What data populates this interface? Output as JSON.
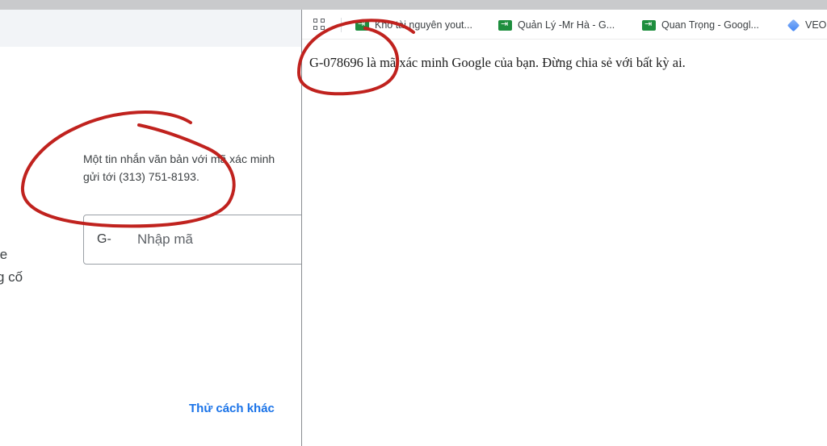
{
  "left_window": {
    "sms_line_1": "Một tin nhắn văn bản với mã xác minh",
    "sms_line_2": "gửi tới (313) 751-8193.",
    "code_prefix": "G-",
    "code_input_value": "",
    "code_input_placeholder": "Nhập mã",
    "side_text_1": "le",
    "side_text_2": "g cố",
    "try_another_way": "Thử cách khác"
  },
  "right_window": {
    "bookmarks": [
      {
        "label": "Kho tài nguyên yout...",
        "icon": "bookmark-folder-icon"
      },
      {
        "label": "Quản Lý -Mr Hà - G...",
        "icon": "bookmark-folder-icon"
      },
      {
        "label": "Quan Trọng - Googl...",
        "icon": "bookmark-folder-icon"
      },
      {
        "label": "VEO",
        "icon": "veo-icon"
      }
    ],
    "message": "G-078696 là mã xác minh Google của bạn. Đừng chia sẻ với bất kỳ ai."
  },
  "colors": {
    "annotation_red": "#c0221e",
    "link_blue": "#1a73e8",
    "bookmark_green": "#1e8e3e"
  }
}
